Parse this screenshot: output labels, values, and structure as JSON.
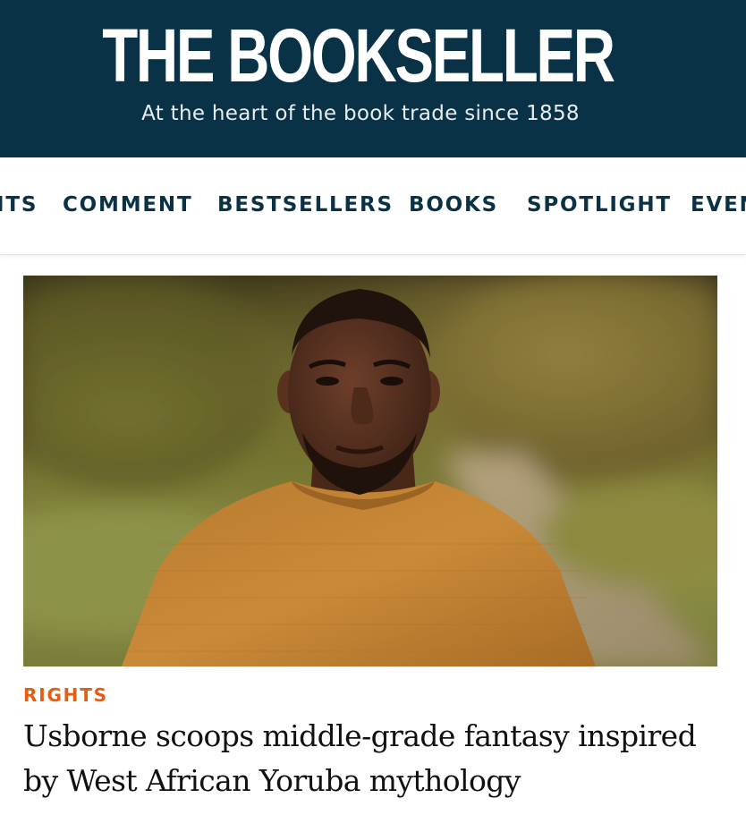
{
  "masthead": {
    "logo_text": "THE BOOKSELLER",
    "tagline": "At the heart of the book trade since 1858",
    "background_color": "#093246"
  },
  "nav": {
    "items": [
      {
        "label": "ITS"
      },
      {
        "label": "COMMENT"
      },
      {
        "label": "BESTSELLERS"
      },
      {
        "label": "BOOKS"
      },
      {
        "label": "SPOTLIGHT"
      },
      {
        "label": "EVEN"
      }
    ],
    "text_color": "#093246"
  },
  "article": {
    "category": "RIGHTS",
    "category_color": "#e35d12",
    "headline": "Usborne scoops middle-grade fantasy inspired by West African Yoruba mythology"
  }
}
